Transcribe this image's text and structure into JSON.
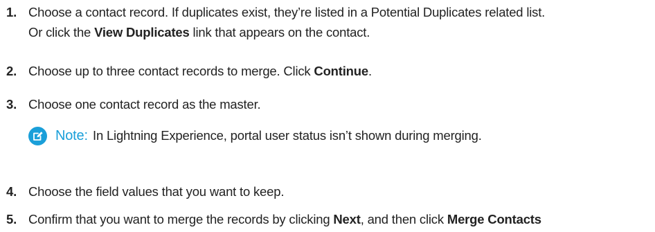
{
  "steps": [
    {
      "number": "1.",
      "line1": "Choose a contact record. If duplicates exist, they’re listed in a Potential Duplicates related list.",
      "line2_before": "Or click the ",
      "line2_bold": "View Duplicates",
      "line2_after": " link that appears on the contact."
    },
    {
      "number": "2.",
      "before": "Choose up to three contact records to merge. Click ",
      "bold": "Continue",
      "after": "."
    },
    {
      "number": "3.",
      "text": "Choose one contact record as the master."
    },
    {
      "number": "4.",
      "text": "Choose the field values that you want to keep."
    },
    {
      "number": "5.",
      "before": "Confirm that you want to merge the records by clicking ",
      "bold1": "Next",
      "middle": ", and then click ",
      "bold2": "Merge Contacts"
    }
  ],
  "note": {
    "icon": "edit-note-icon",
    "label": "Note:",
    "text": "In Lightning Experience, portal user status isn’t shown during merging."
  },
  "colors": {
    "accent": "#1a9fd9",
    "text": "#222222"
  }
}
